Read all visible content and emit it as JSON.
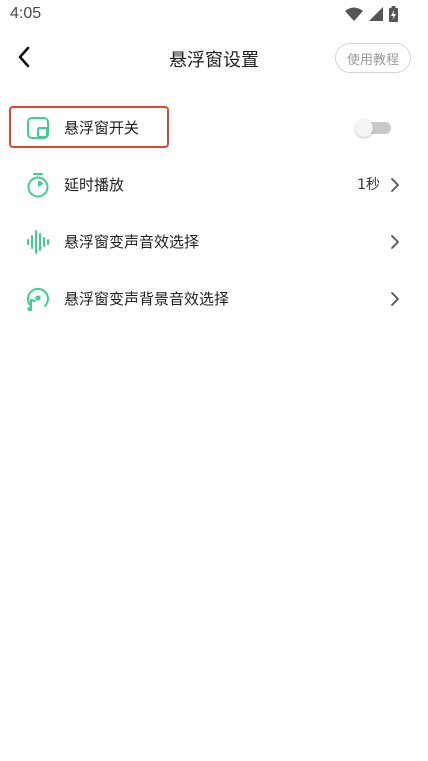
{
  "status_bar": {
    "time": "4:05",
    "icons": [
      "wifi-icon",
      "signal-icon",
      "battery-charging-icon"
    ]
  },
  "header": {
    "back_icon": "chevron-left-icon",
    "title": "悬浮窗设置",
    "tutorial_label": "使用教程"
  },
  "settings": {
    "items": [
      {
        "icon": "floating-window-icon",
        "label": "悬浮窗开关",
        "control": "toggle",
        "toggle_on": false,
        "highlighted": true
      },
      {
        "icon": "timer-icon",
        "label": "延时播放",
        "value": "1秒",
        "control": "chevron"
      },
      {
        "icon": "soundwave-icon",
        "label": "悬浮窗变声音效选择",
        "control": "chevron"
      },
      {
        "icon": "music-disc-icon",
        "label": "悬浮窗变声背景音效选择",
        "control": "chevron"
      }
    ]
  },
  "colors": {
    "accent_green": "#3ecf8e",
    "highlight_red": "#d9482f",
    "toggle_off": "#c9c9c9"
  }
}
